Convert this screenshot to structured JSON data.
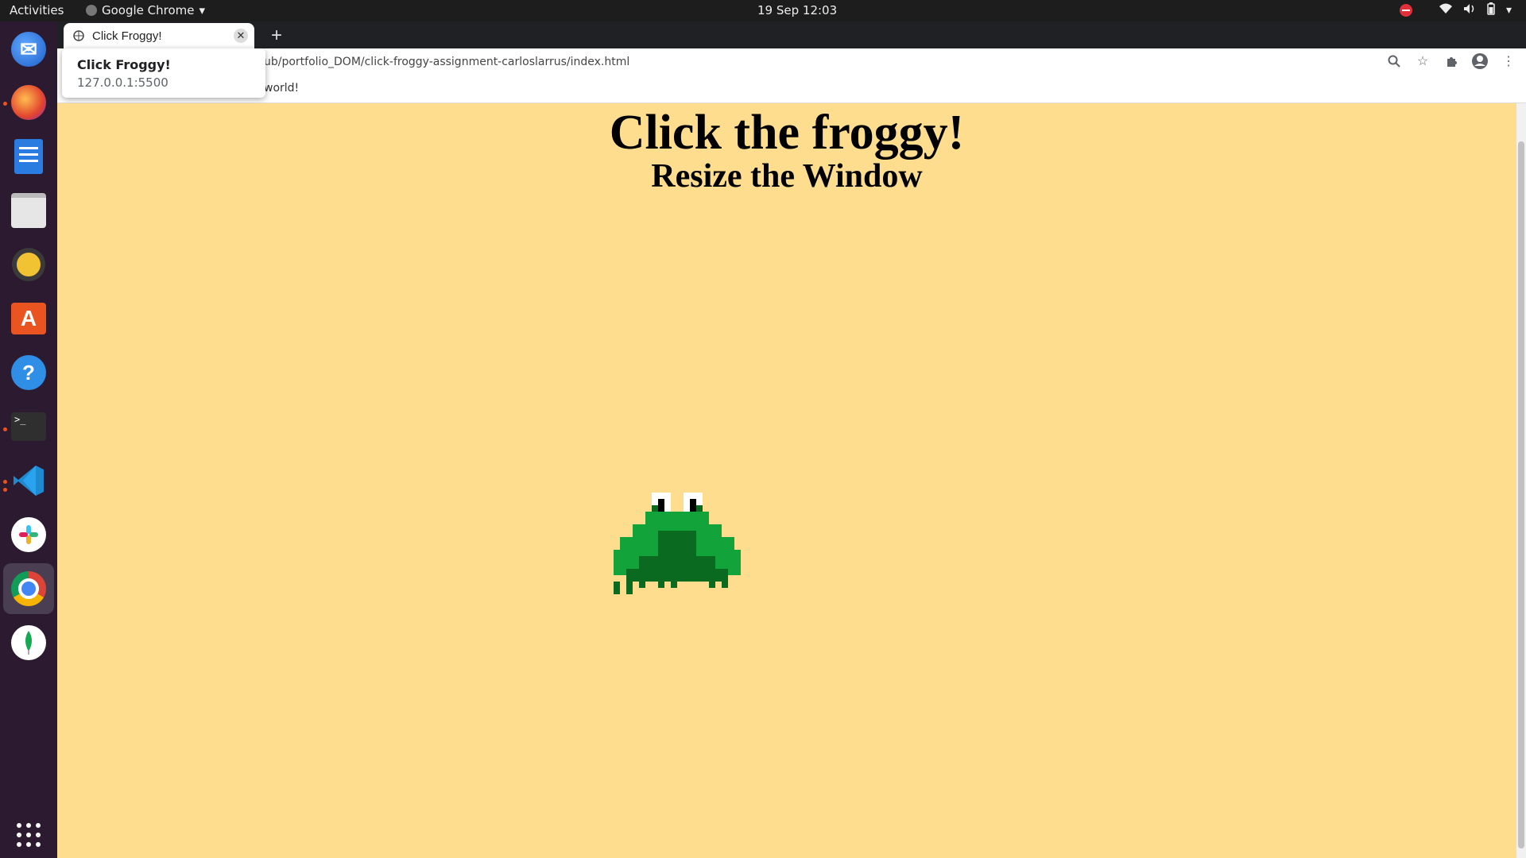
{
  "topbar": {
    "activities": "Activities",
    "app_name": "Google Chrome",
    "clock": "19 Sep  12:03"
  },
  "dock": {
    "items": [
      "thunderbird-icon",
      "firefox-icon",
      "writer-icon",
      "files-icon",
      "rhythmbox-icon",
      "software-icon",
      "help-icon",
      "terminal-icon",
      "vscode-icon",
      "slack-icon",
      "chrome-icon",
      "mongodb-icon",
      "app-grid-icon"
    ]
  },
  "browser": {
    "tab_title": "Click Froggy!",
    "new_tab_symbol": "+",
    "url": "ub/portfolio_DOM/click-froggy-assignment-carloslarrus/index.html",
    "bookmark": "world!",
    "hovercard": {
      "title": "Click Froggy!",
      "host": "127.0.0.1:5500"
    }
  },
  "page": {
    "heading": "Click the froggy!",
    "subheading": "Resize the Window",
    "background": "#fedd8e"
  },
  "colors": {
    "accent": "#e95420",
    "frog_light": "#12a33a",
    "frog_dark": "#0a6a1f"
  }
}
